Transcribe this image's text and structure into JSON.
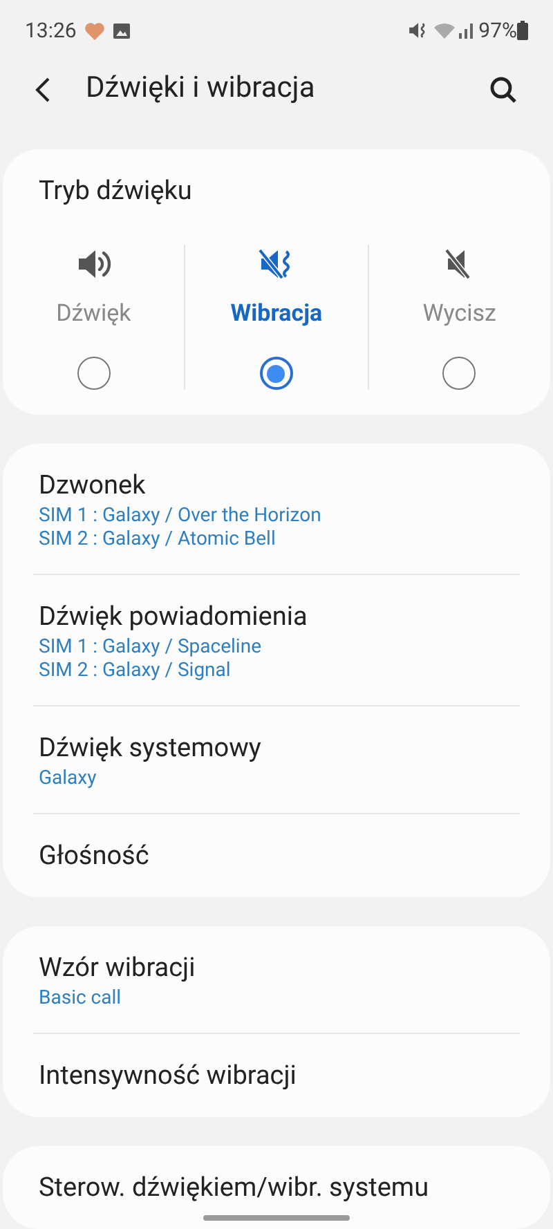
{
  "status_bar": {
    "time": "13:26",
    "battery": "97%"
  },
  "header": {
    "title": "Dźwięki i wibracja"
  },
  "sound_mode": {
    "title": "Tryb dźwięku",
    "modes": [
      {
        "kind": "sound",
        "label": "Dźwięk",
        "selected": false
      },
      {
        "kind": "vibrate",
        "label": "Wibracja",
        "selected": true
      },
      {
        "kind": "mute",
        "label": "Wycisz",
        "selected": false
      }
    ]
  },
  "groups": [
    {
      "items": [
        {
          "title": "Dzwonek",
          "subtitles": [
            "SIM 1 : Galaxy / Over the Horizon",
            "SIM 2 : Galaxy / Atomic Bell"
          ]
        },
        {
          "title": "Dźwięk powiadomienia",
          "subtitles": [
            "SIM 1 : Galaxy / Spaceline",
            "SIM 2 : Galaxy / Signal"
          ]
        },
        {
          "title": "Dźwięk systemowy",
          "subtitles": [
            "Galaxy"
          ]
        },
        {
          "title": "Głośność"
        }
      ]
    },
    {
      "items": [
        {
          "title": "Wzór wibracji",
          "subtitles": [
            "Basic call"
          ]
        },
        {
          "title": "Intensywność wibracji"
        }
      ]
    },
    {
      "items": [
        {
          "title": "Sterow. dźwiękiem/wibr. systemu"
        }
      ]
    }
  ]
}
